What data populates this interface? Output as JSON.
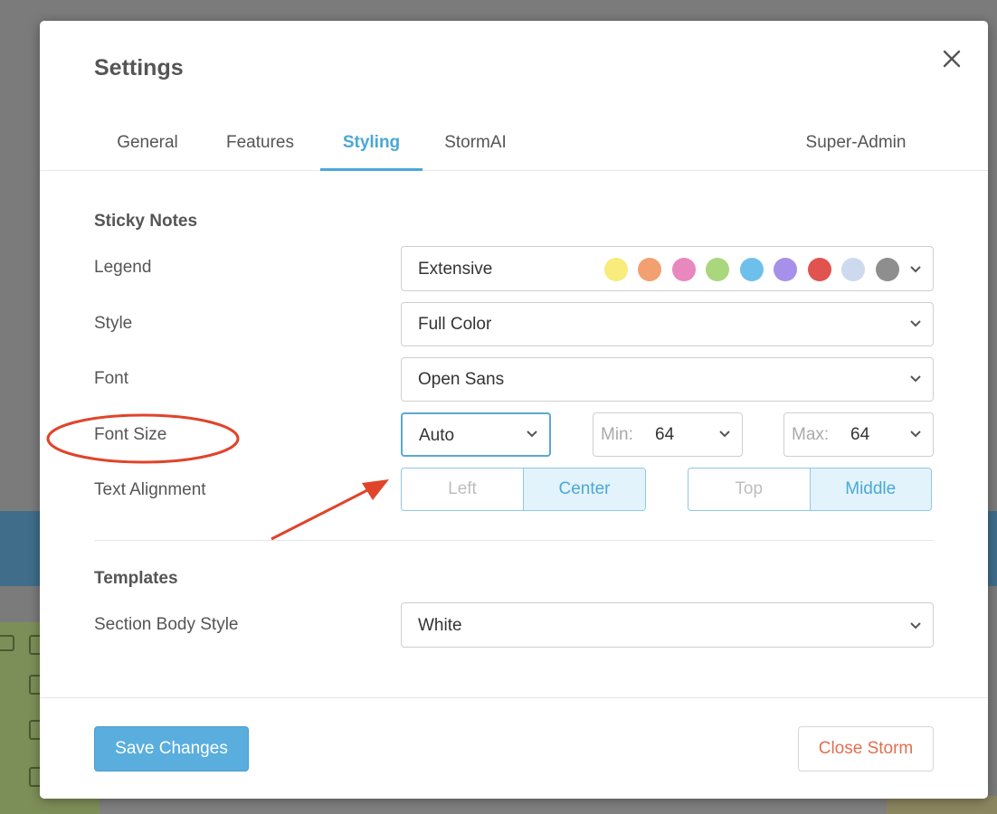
{
  "dialog": {
    "title": "Settings",
    "close_icon": "close-icon"
  },
  "tabs": [
    {
      "label": "General",
      "active": false
    },
    {
      "label": "Features",
      "active": false
    },
    {
      "label": "Styling",
      "active": true
    },
    {
      "label": "StormAI",
      "active": false
    },
    {
      "label": "Super-Admin",
      "active": false
    }
  ],
  "sticky_notes": {
    "heading": "Sticky Notes",
    "legend": {
      "label": "Legend",
      "value": "Extensive",
      "colors": [
        "#f7ec7c",
        "#f2a070",
        "#e987bf",
        "#a9d77c",
        "#6ec0ec",
        "#a690ea",
        "#e0534e",
        "#cdd9ee",
        "#8e8e8e"
      ]
    },
    "style": {
      "label": "Style",
      "value": "Full Color"
    },
    "font": {
      "label": "Font",
      "value": "Open Sans"
    },
    "font_size": {
      "label": "Font Size",
      "value": "Auto",
      "min_label": "Min:",
      "min_value": "64",
      "max_label": "Max:",
      "max_value": "64"
    },
    "text_alignment": {
      "label": "Text Alignment",
      "horizontal": [
        "Left",
        "Center"
      ],
      "horizontal_selected": "Center",
      "vertical": [
        "Top",
        "Middle"
      ],
      "vertical_selected": "Middle"
    }
  },
  "templates": {
    "heading": "Templates",
    "section_body_style": {
      "label": "Section Body Style",
      "value": "White"
    }
  },
  "footer": {
    "save_label": "Save Changes",
    "close_storm_label": "Close Storm"
  },
  "colors": {
    "accent": "#4aa8d6",
    "save_button": "#5aaede",
    "danger_text": "#e0704f",
    "annotation_red": "#e0442a"
  }
}
